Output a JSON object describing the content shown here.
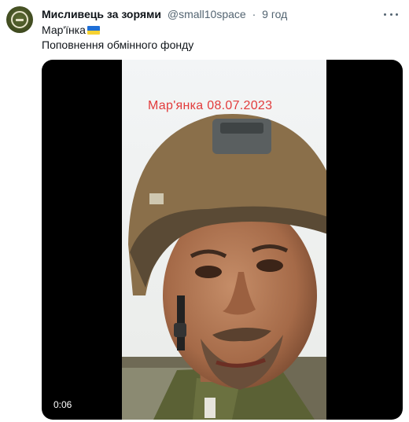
{
  "tweet": {
    "author_name": "Мисливець за зорями",
    "author_handle": "@small10space",
    "separator": "·",
    "time_ago": "9 год",
    "line1_text": "Мар'їнка",
    "line1_flag": "ukraine-flag-icon",
    "line2_text": "Поповнення обмінного фонду"
  },
  "video": {
    "overlay_caption": "Мар'янка 08.07.2023",
    "duration": "0:06"
  },
  "colors": {
    "handle_gray": "#536471",
    "caption_red": "#e23b3b",
    "flag_blue": "#1f6fd6",
    "flag_yellow": "#f6d233"
  }
}
